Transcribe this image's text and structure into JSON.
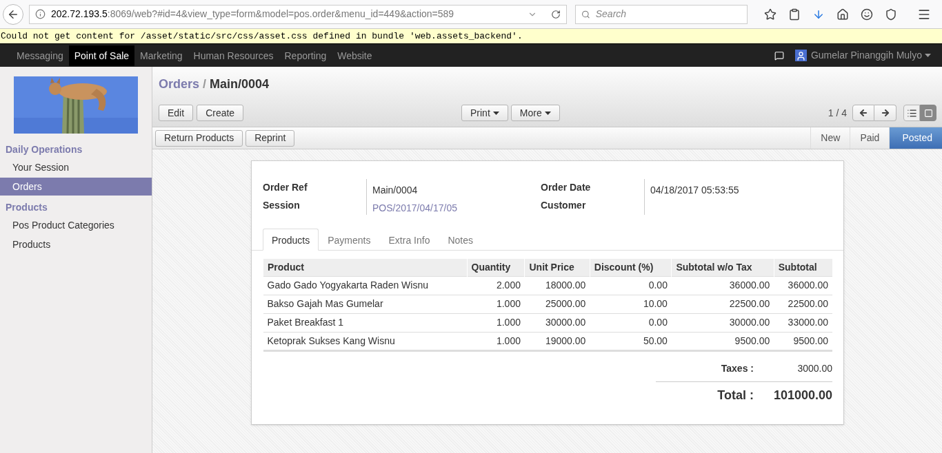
{
  "browser": {
    "url_host": "202.72.193.5",
    "url_rest": ":8069/web?#id=4&view_type=form&model=pos.order&menu_id=449&action=589",
    "search_placeholder": "Search"
  },
  "error_banner": "Could not get content for /asset/static/src/css/asset.css defined in bundle 'web.assets_backend'.",
  "top_menu": [
    {
      "label": "Messaging",
      "selected": false
    },
    {
      "label": "Point of Sale",
      "selected": true
    },
    {
      "label": "Marketing",
      "selected": false
    },
    {
      "label": "Human Resources",
      "selected": false
    },
    {
      "label": "Reporting",
      "selected": false
    },
    {
      "label": "Website",
      "selected": false
    }
  ],
  "user": {
    "name": "Gumelar Pinanggih Mulyo"
  },
  "sidebar": {
    "sections": [
      {
        "title": "Daily Operations",
        "items": [
          {
            "label": "Your Session",
            "selected": false
          },
          {
            "label": "Orders",
            "selected": true
          }
        ]
      },
      {
        "title": "Products",
        "items": [
          {
            "label": "Pos Product Categories",
            "selected": false
          },
          {
            "label": "Products",
            "selected": false
          }
        ]
      }
    ]
  },
  "breadcrumb": {
    "parent": "Orders",
    "separator": "/",
    "current": "Main/0004"
  },
  "buttons_left": [
    "Edit",
    "Create"
  ],
  "buttons_center": [
    "Print",
    "More"
  ],
  "pager": "1 / 4",
  "action_buttons": [
    "Return Products",
    "Reprint"
  ],
  "statusbar": [
    {
      "label": "New",
      "selected": false
    },
    {
      "label": "Paid",
      "selected": false
    },
    {
      "label": "Posted",
      "selected": true
    }
  ],
  "fields_left": [
    {
      "label": "Order Ref",
      "value": "Main/0004",
      "kind": "text"
    },
    {
      "label": "Session",
      "value": "POS/2017/04/17/05",
      "kind": "link"
    }
  ],
  "fields_right": [
    {
      "label": "Order Date",
      "value": "04/18/2017 05:53:55"
    },
    {
      "label": "Customer"
    }
  ],
  "tabs": [
    {
      "label": "Products",
      "selected": true
    },
    {
      "label": "Payments",
      "selected": false
    },
    {
      "label": "Extra Info",
      "selected": false
    },
    {
      "label": "Notes",
      "selected": false
    }
  ],
  "table": {
    "columns": [
      "Product",
      "Quantity",
      "Unit Price",
      "Discount (%)",
      "Subtotal w/o Tax",
      "Subtotal"
    ],
    "rows": [
      [
        "Gado Gado Yogyakarta Raden Wisnu",
        "2.000",
        "18000.00",
        "0.00",
        "36000.00",
        "36000.00"
      ],
      [
        "Bakso Gajah Mas Gumelar",
        "1.000",
        "25000.00",
        "10.00",
        "22500.00",
        "22500.00"
      ],
      [
        "Paket Breakfast 1",
        "1.000",
        "30000.00",
        "0.00",
        "30000.00",
        "33000.00"
      ],
      [
        "Ketoprak Sukses Kang Wisnu",
        "1.000",
        "19000.00",
        "50.00",
        "9500.00",
        "9500.00"
      ]
    ]
  },
  "totals": {
    "taxes_label": "Taxes :",
    "taxes": "3000.00",
    "total_label": "Total :",
    "total": "101000.00"
  }
}
